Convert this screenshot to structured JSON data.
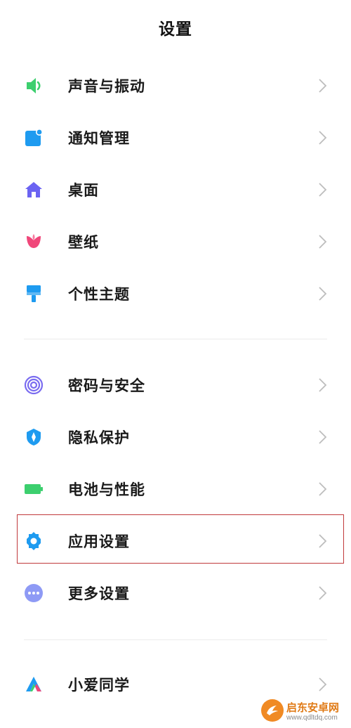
{
  "header": {
    "title": "设置"
  },
  "groups": [
    {
      "items": [
        {
          "label": "声音与振动",
          "icon": "speaker-icon",
          "color": "#3ccf6e"
        },
        {
          "label": "通知管理",
          "icon": "notification-icon",
          "color": "#1e9bf0"
        },
        {
          "label": "桌面",
          "icon": "home-icon",
          "color": "#6b63f2"
        },
        {
          "label": "壁纸",
          "icon": "tulip-icon",
          "color": "#f0477a"
        },
        {
          "label": "个性主题",
          "icon": "paint-brush-icon",
          "color": "#1e9bf0"
        }
      ]
    },
    {
      "items": [
        {
          "label": "密码与安全",
          "icon": "fingerprint-icon",
          "color": "#7a6cf0"
        },
        {
          "label": "隐私保护",
          "icon": "privacy-shield-icon",
          "color": "#1e9bf0"
        },
        {
          "label": "电池与性能",
          "icon": "battery-icon",
          "color": "#3ccf6e"
        },
        {
          "label": "应用设置",
          "icon": "gear-icon",
          "color": "#1e9bf0",
          "highlighted": true
        },
        {
          "label": "更多设置",
          "icon": "more-dots-icon",
          "color": "#8e9af5"
        }
      ]
    },
    {
      "items": [
        {
          "label": "小爱同学",
          "icon": "xiaoai-icon",
          "color": "#1e9bf0"
        }
      ]
    }
  ],
  "colors": {
    "chevron": "#bdbdbd",
    "divider": "#ececec",
    "highlight_border": "#c0393b"
  },
  "watermark": {
    "name": "启东安卓网",
    "url": "www.qdltdq.com"
  }
}
